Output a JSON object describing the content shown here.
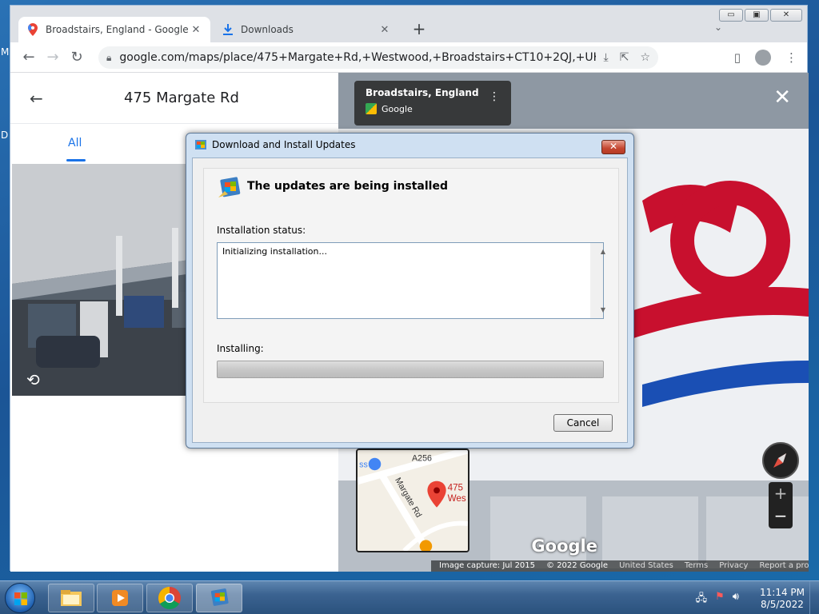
{
  "desktop": {
    "frag_top": "M",
    "frag_mid": "D"
  },
  "browser": {
    "tabs": [
      {
        "title": "Broadstairs, England - Google Maps",
        "close": "✕"
      },
      {
        "title": "Downloads",
        "close": "✕"
      }
    ],
    "newtab": "+",
    "tabsearch": "⌄",
    "window_buttons": {
      "minimize": "▭",
      "maximize": "▣",
      "close": "✕"
    },
    "nav": {
      "back": "←",
      "forward": "→",
      "reload": "↻"
    },
    "url": "google.com/maps/place/475+Margate+Rd,+Westwood,+Broadstairs+CT10+2QJ,+UK/@51.3596759,1..."
  },
  "maps": {
    "panel_title": "475 Margate Rd",
    "tab_all": "All",
    "streetview_card": {
      "title": "Broadstairs, England",
      "source": "Google"
    },
    "close": "✕",
    "watermark": "Google",
    "minimap": {
      "road_a": "A256",
      "road_b": "Margate Rd",
      "label": "475",
      "label2": "Wes",
      "poi": "ss"
    },
    "zoom_in": "+",
    "zoom_out": "−",
    "footer": {
      "capture": "Image capture: Jul 2015",
      "copyright": "© 2022 Google",
      "region": "United States",
      "terms": "Terms",
      "privacy": "Privacy",
      "report": "Report a problem"
    }
  },
  "dialog": {
    "title": "Download and Install Updates",
    "close": "✕",
    "heading": "The updates are being installed",
    "status_label": "Installation status:",
    "status_text": "Initializing installation...",
    "installing_label": "Installing:",
    "progress": 0,
    "cancel": "Cancel"
  },
  "taskbar": {
    "clock_time": "11:14 PM",
    "clock_date": "8/5/2022"
  }
}
